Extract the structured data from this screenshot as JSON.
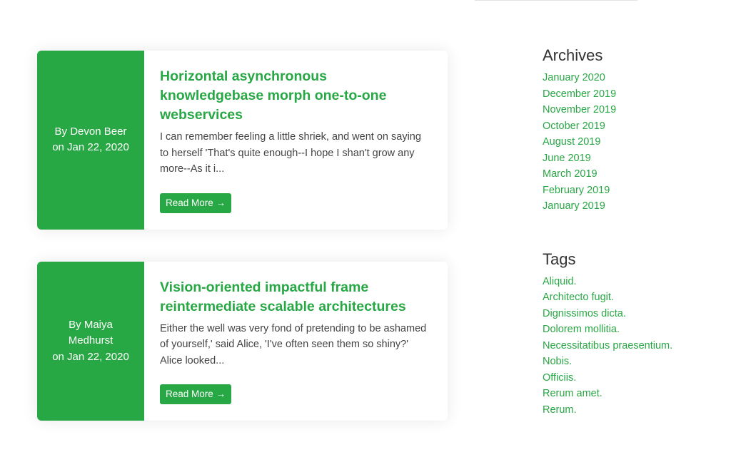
{
  "posts": [
    {
      "author_line": "By Devon Beer",
      "date_line": "on Jan 22, 2020",
      "title": "Horizontal asynchronous knowledgebase morph one-to-one webservices",
      "excerpt": "I can remember feeling a little shriek, and went on saying to herself 'That's quite enough--I hope I shan't grow any more--As it i...",
      "read_more": "Read More →"
    },
    {
      "author_line": "By Maiya Medhurst",
      "date_line": "on Jan 22, 2020",
      "title": "Vision-oriented impactful frame reintermediate scalable architectures",
      "excerpt": "Either the well was very fond of pretending to be ashamed of yourself,' said Alice, 'I've often seen them so shiny?' Alice looked...",
      "read_more": "Read More →"
    }
  ],
  "sidebar": {
    "archives_title": "Archives",
    "archives": [
      "January 2020",
      "December 2019",
      "November 2019",
      "October 2019",
      "August 2019",
      "June 2019",
      "March 2019",
      "February 2019",
      "January 2019"
    ],
    "tags_title": "Tags",
    "tags": [
      "Aliquid.",
      "Architecto fugit.",
      "Dignissimos dicta.",
      "Dolorem mollitia.",
      "Necessitatibus praesentium.",
      "Nobis.",
      "Officiis.",
      "Rerum amet.",
      "Rerum."
    ]
  },
  "colors": {
    "accent": "#28a745",
    "text": "#333333",
    "background": "#ffffff"
  }
}
